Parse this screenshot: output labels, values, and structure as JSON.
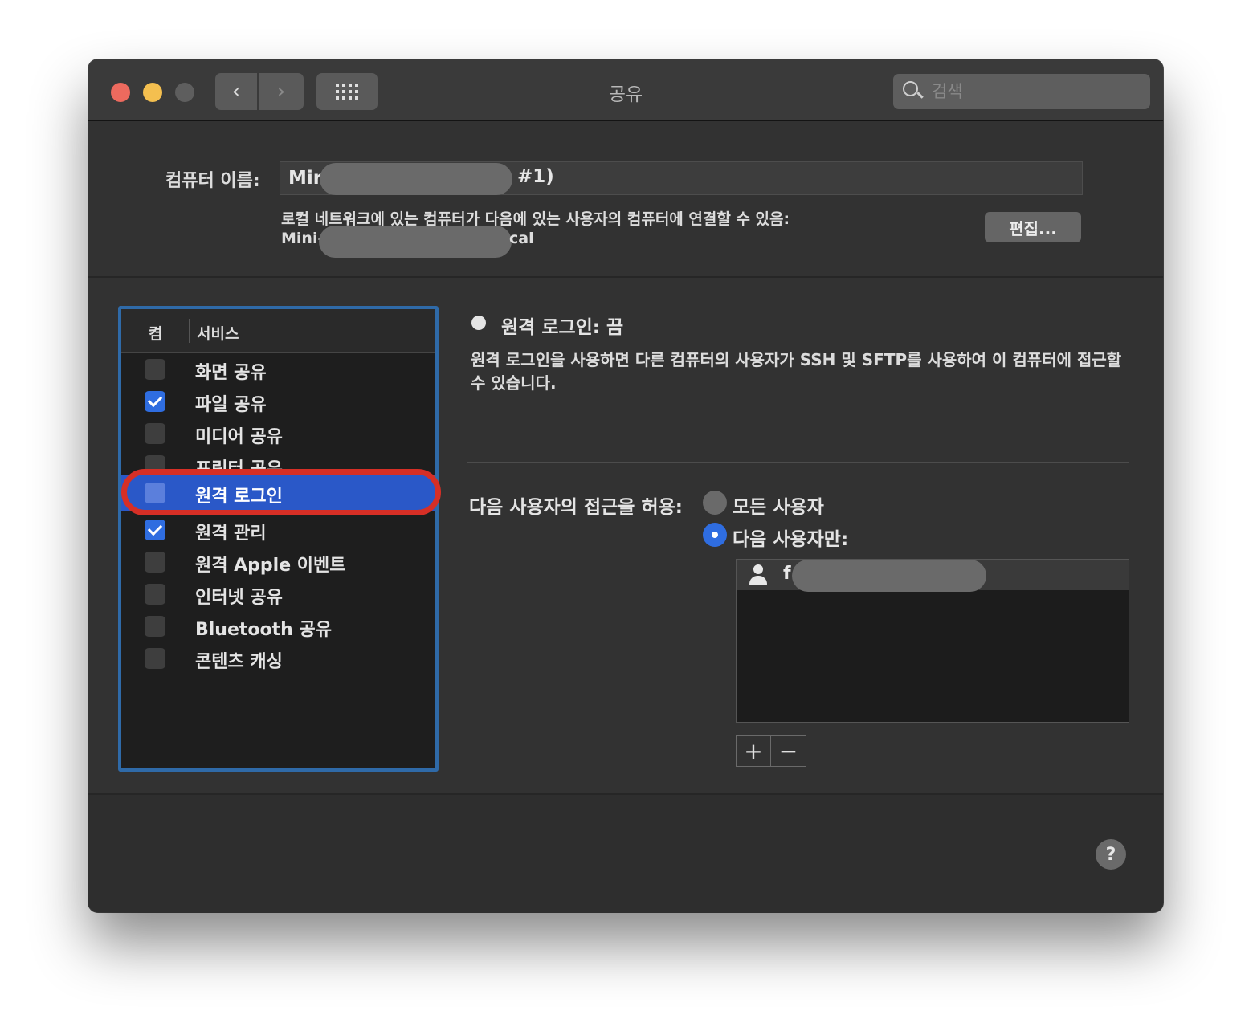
{
  "window": {
    "title": "공유"
  },
  "toolbar": {
    "back_glyph": "‹",
    "forward_glyph": "›"
  },
  "search": {
    "placeholder": "검색"
  },
  "computer_name": {
    "label": "컴퓨터 이름:",
    "value_prefix": "Mir",
    "value_suffix": "#1)",
    "local_description": "로컬 네트워크에 있는 컴퓨터가 다음에 있는 사용자의 컴퓨터에 연결할 수 있음:",
    "local_hostname_prefix": "Mini-",
    "local_hostname_suffix": "cal",
    "edit_button": "편집..."
  },
  "services": {
    "header_on": "켬",
    "header_service": "서비스",
    "items": [
      {
        "label": "화면 공유",
        "checked": false
      },
      {
        "label": "파일 공유",
        "checked": true
      },
      {
        "label": "미디어 공유",
        "checked": false
      },
      {
        "label": "프린터 공유",
        "checked": false
      },
      {
        "label": "원격 로그인",
        "checked": false,
        "selected": true
      },
      {
        "label": "원격 관리",
        "checked": true
      },
      {
        "label": "원격 Apple 이벤트",
        "checked": false
      },
      {
        "label": "인터넷 공유",
        "checked": false
      },
      {
        "label": "Bluetooth 공유",
        "checked": false
      },
      {
        "label": "콘텐츠 캐싱",
        "checked": false
      }
    ]
  },
  "detail": {
    "status": "원격 로그인: 끔",
    "description": "원격 로그인을 사용하면 다른 컴퓨터의 사용자가 SSH 및 SFTP를 사용하여 이 컴퓨터에 접근할 수 있습니다.",
    "access_label": "다음 사용자의 접근을 허용:",
    "option_all": "모든 사용자",
    "option_only": "다음 사용자만:",
    "selected_option": "option_only",
    "users": [
      {
        "name": "f"
      }
    ],
    "add_glyph": "+",
    "remove_glyph": "−"
  },
  "help": {
    "glyph": "?"
  },
  "colors": {
    "accent": "#2f6de0",
    "selection": "#2a58c8",
    "highlight_ring": "#d62f26",
    "close": "#ed6a5e",
    "minimize": "#f4bf4f"
  }
}
